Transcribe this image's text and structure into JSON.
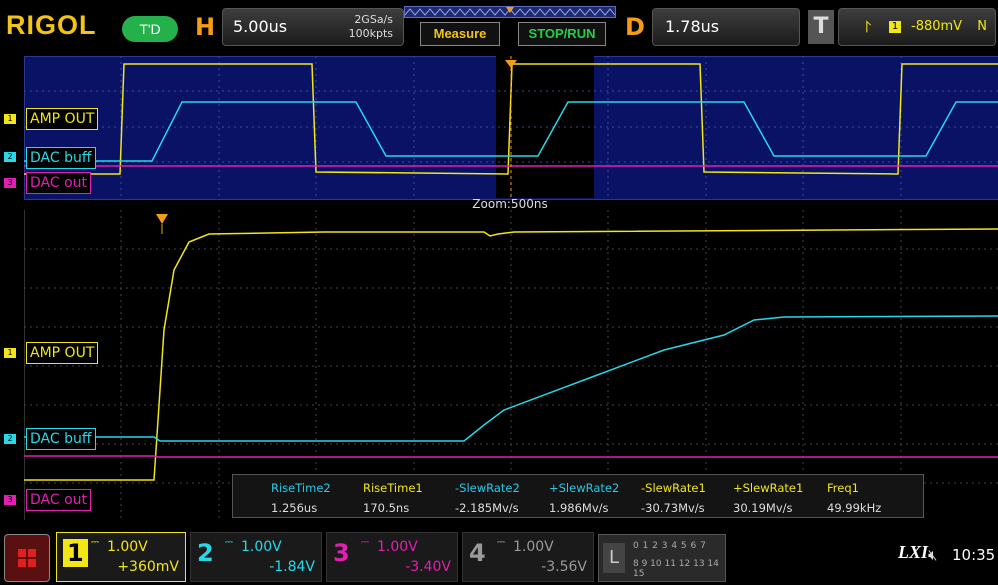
{
  "header": {
    "brand": "RIGOL",
    "mode_badge": "T'D",
    "horizontal_letter": "H",
    "timebase": "5.00us",
    "sample_rate": "2GSa/s",
    "memory_depth": "100kpts",
    "measure_label": "Measure",
    "stoprun_label": "STOP/RUN",
    "delay_letter": "D",
    "delay": "1.78us",
    "trigger_letter": "T",
    "trigger_source": "1",
    "trigger_level": "-880mV",
    "trigger_mode": "N"
  },
  "zoom_label": "Zoom:500ns",
  "channel_tags": {
    "ch1": {
      "label": "AMP OUT",
      "num": "1",
      "color": "#f2e617"
    },
    "ch2": {
      "label": "DAC buff",
      "num": "2",
      "color": "#27d8e8"
    },
    "ch3": {
      "label": "DAC out",
      "num": "3",
      "color": "#e020b0"
    }
  },
  "measurements": [
    {
      "name": "RiseTime2",
      "value": "1.256us",
      "color": "#27c8e8"
    },
    {
      "name": "RiseTime1",
      "value": "170.5ns",
      "color": "#f2e617"
    },
    {
      "name": "-SlewRate2",
      "value": "-2.185Mv/s",
      "color": "#27c8e8"
    },
    {
      "name": "+SlewRate2",
      "value": "1.986Mv/s",
      "color": "#27c8e8"
    },
    {
      "name": "-SlewRate1",
      "value": "-30.73Mv/s",
      "color": "#f2e617"
    },
    {
      "name": "+SlewRate1",
      "value": "30.19Mv/s",
      "color": "#f2e617"
    },
    {
      "name": "Freq1",
      "value": "49.99kHz",
      "color": "#f2e617"
    }
  ],
  "channels_bottom": [
    {
      "num": "1",
      "scale": "1.00V",
      "offset": "+360mV",
      "color": "#f2e617"
    },
    {
      "num": "2",
      "scale": "1.00V",
      "offset": "-1.84V",
      "color": "#27d8e8"
    },
    {
      "num": "3",
      "scale": "1.00V",
      "offset": "-3.40V",
      "color": "#e020b0"
    },
    {
      "num": "4",
      "scale": "1.00V",
      "offset": "-3.56V",
      "color": "#999999"
    }
  ],
  "logic": {
    "letter": "L",
    "row1": "0 1 2 3   4 5 6 7",
    "row2": "8 9 10 11 12 13 14 15"
  },
  "status": {
    "lxi": "LXI",
    "clock": "10:35"
  }
}
